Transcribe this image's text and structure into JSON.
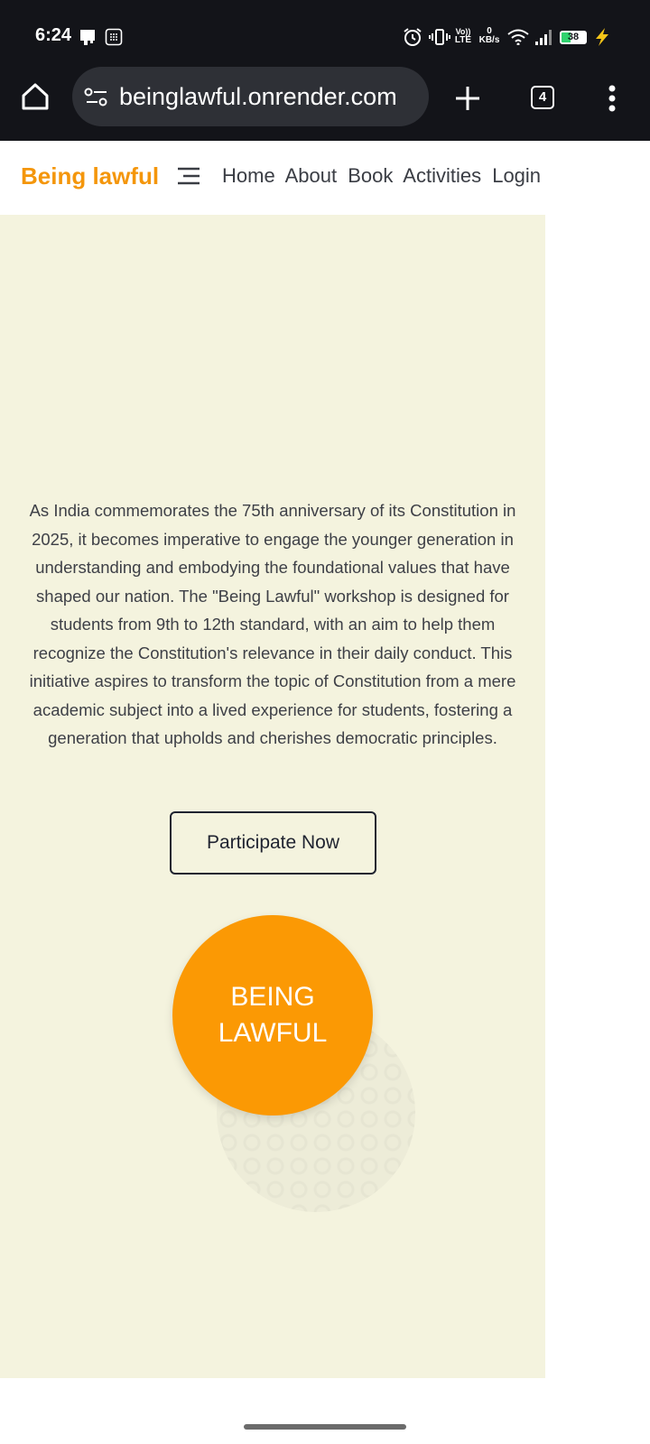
{
  "status_bar": {
    "time": "6:24",
    "network_speed_value": "0",
    "network_speed_unit": "KB/s",
    "volte_label_top": "Vo))",
    "volte_label_bottom": "LTE",
    "battery_level": "38",
    "battery_color": "#2fd36e"
  },
  "browser": {
    "url": "beinglawful.onrender.com",
    "tab_count": "4"
  },
  "site": {
    "brand": "Being lawful",
    "brand_color": "#f4960b",
    "nav": [
      "Home",
      "About",
      "Book",
      "Activities",
      "Login"
    ]
  },
  "main": {
    "intro": "As India commemorates the 75th anniversary of its Constitution in 2025, it becomes imperative to engage the younger generation in understanding and embodying the foundational values that have shaped our nation. The \"Being Lawful\" workshop is designed for students from 9th to 12th standard, with an aim to help them recognize the Constitution's relevance in their daily conduct. This initiative aspires to transform the topic of Constitution from a mere academic subject into a lived experience for students, fostering a generation that upholds and cherishes democratic principles.",
    "cta_label": "Participate Now",
    "logo_text": "BEING\nLAWFUL",
    "logo_color": "#fb9904",
    "background_color": "#f4f3de"
  }
}
